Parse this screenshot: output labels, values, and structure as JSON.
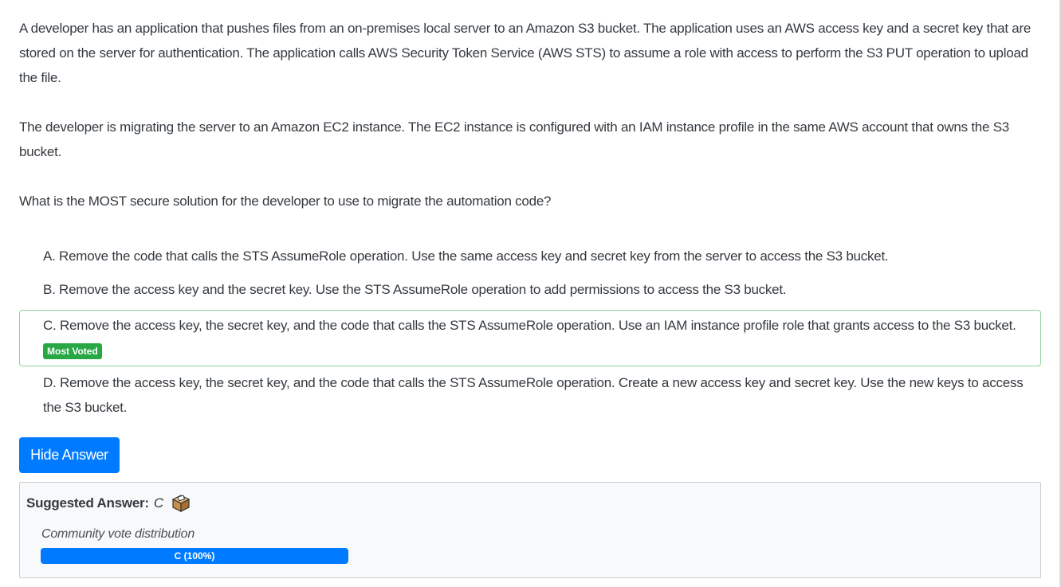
{
  "question": {
    "paragraphs": [
      "A developer has an application that pushes files from an on-premises local server to an Amazon S3 bucket. The application uses an AWS access key and a secret key that are stored on the server for authentication. The application calls AWS Security Token Service (AWS STS) to assume a role with access to perform the S3 PUT operation to upload the file.",
      "The developer is migrating the server to an Amazon EC2 instance. The EC2 instance is configured with an IAM instance profile in the same AWS account that owns the S3 bucket.",
      "What is the MOST secure solution for the developer to use to migrate the automation code?"
    ]
  },
  "choices": [
    {
      "letter": "A.",
      "text": "Remove the code that calls the STS AssumeRole operation. Use the same access key and secret key from the server to access the S3 bucket."
    },
    {
      "letter": "B.",
      "text": "Remove the access key and the secret key. Use the STS AssumeRole operation to add permissions to access the S3 bucket."
    },
    {
      "letter": "C.",
      "text": "Remove the access key, the secret key, and the code that calls the STS AssumeRole operation. Use an IAM instance profile role that grants access to the S3 bucket.",
      "badge": "Most Voted"
    },
    {
      "letter": "D.",
      "text": "Remove the access key, the secret key, and the code that calls the STS AssumeRole operation. Create a new access key and secret key. Use the new keys to access the S3 bucket."
    }
  ],
  "hide_answer_label": "Hide Answer",
  "answer": {
    "label": "Suggested Answer:",
    "value": "C",
    "icon": "ballot-box-icon",
    "vote_title": "Community vote distribution",
    "votes": [
      {
        "label": "C (100%)",
        "percent": 100
      }
    ]
  },
  "colors": {
    "accent": "#007bff",
    "badge": "#28a745",
    "correct_border": "#8fd19e"
  }
}
